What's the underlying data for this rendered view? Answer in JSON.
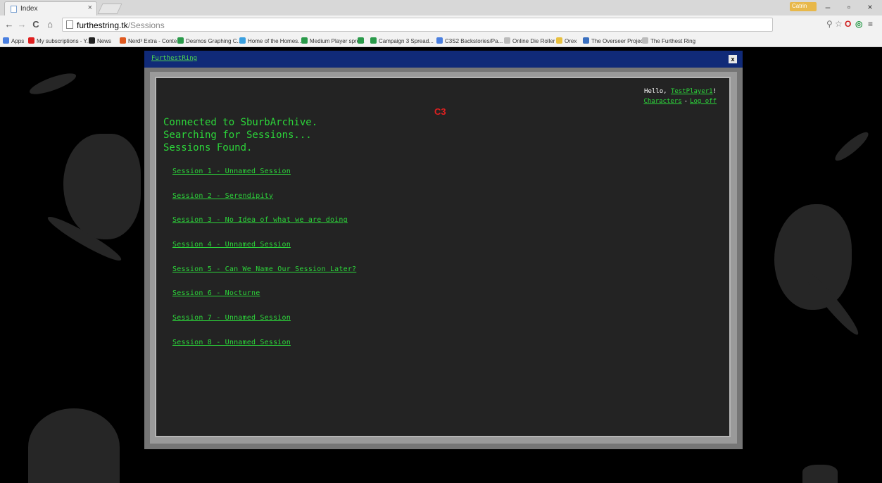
{
  "browser": {
    "tab_title": "Index",
    "tab_close": "×",
    "profile_badge": "Catrin",
    "win_min": "–",
    "win_max": "▫",
    "win_close": "×",
    "back": "←",
    "forward": "→",
    "reload": "C",
    "home": "⌂",
    "url_host": "furthestring.tk",
    "url_path": "/Sessions",
    "bookmarks": [
      {
        "label": "Apps",
        "color": "#4a7fe0"
      },
      {
        "label": "My subscriptions - Y...",
        "color": "#e02020"
      },
      {
        "label": "News",
        "color": "#222222"
      },
      {
        "label": "Nerd³ Extra - Conte...",
        "color": "#e05a20"
      },
      {
        "label": "Desmos Graphing C...",
        "color": "#2a9a4a"
      },
      {
        "label": "Home of the Homes...",
        "color": "#3aa0e0"
      },
      {
        "label": "Medium Player spre...",
        "color": "#2a9a4a"
      },
      {
        "label": "",
        "color": "#2a9a4a"
      },
      {
        "label": "Campaign 3 Spread...",
        "color": "#2a9a4a"
      },
      {
        "label": "C3S2 Backstories/Pa...",
        "color": "#4a7fe0"
      },
      {
        "label": "Online Die Roller",
        "color": "#bbbbbb"
      },
      {
        "label": "Orex",
        "color": "#e8c040"
      },
      {
        "label": "The Overseer Project",
        "color": "#3a70c0"
      },
      {
        "label": "The Furthest Ring",
        "color": "#bbbbbb"
      }
    ]
  },
  "app": {
    "title": "FurthestRing",
    "close": "x",
    "greeting": "Hello,",
    "username": "TestPlayer1",
    "greeting_end": "!",
    "characters_link": "Characters",
    "dash": "-",
    "logoff_link": "Log off",
    "logo": "C3",
    "console_lines": [
      "Connected to SburbArchive.",
      "Searching for Sessions...",
      "Sessions Found."
    ],
    "sessions": [
      "Session 1 - Unnamed Session",
      "Session 2 - Serendipity",
      "Session 3 - No Idea of what we are doing",
      "Session 4 - Unnamed Session",
      "Session 5 - Can We Name Our Session Later?",
      "Session 6 - Nocturne",
      "Session 7 - Unnamed Session",
      "Session 8 - Unnamed Session"
    ]
  },
  "colors": {
    "terminal_bg": "#232323",
    "terminal_text": "#2cd63a",
    "titlebar": "#102a78",
    "logo": "#e02020"
  }
}
